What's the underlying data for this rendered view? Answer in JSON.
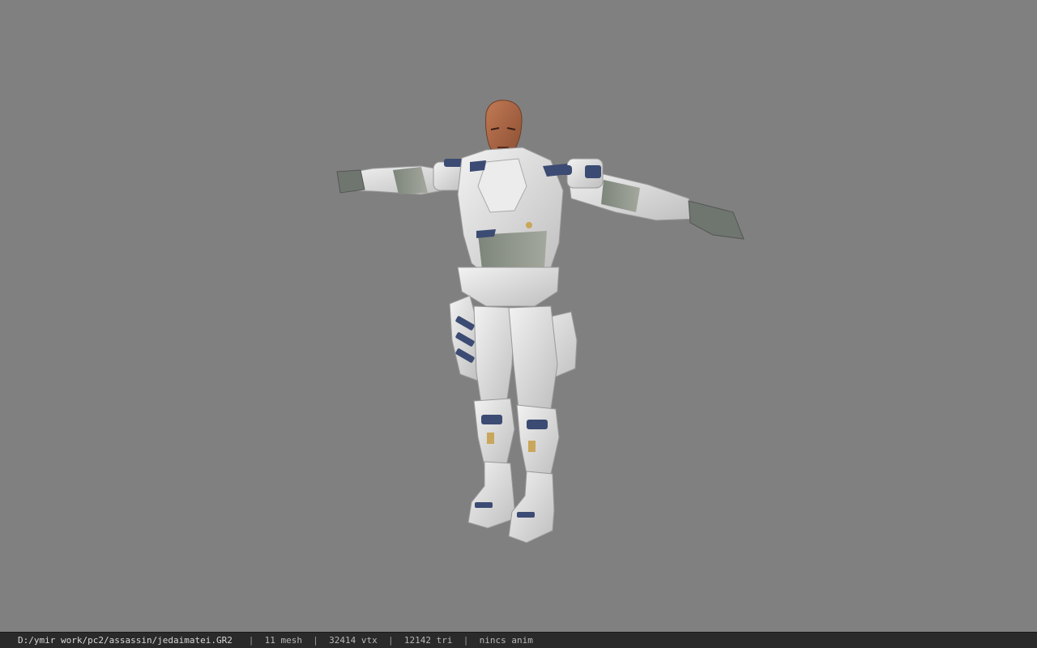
{
  "viewer": {
    "background_color": "#808080",
    "model_icon": "character-model-tpose"
  },
  "status": {
    "file_path": "D:/ymir work/pc2/assassin/jedaimatei.GR2",
    "separator": "|",
    "mesh_count": "11 mesh",
    "vertex_count": "32414 vtx",
    "triangle_count": "12142 tri",
    "animation": "nincs anim"
  }
}
